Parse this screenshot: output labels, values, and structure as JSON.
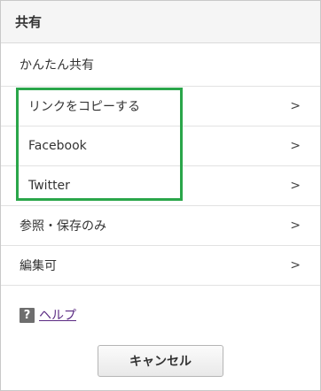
{
  "header": {
    "title": "共有"
  },
  "section": {
    "label": "かんたん共有"
  },
  "share_items": [
    {
      "label": "リンクをコピーする",
      "chevron": ">"
    },
    {
      "label": "Facebook",
      "chevron": ">"
    },
    {
      "label": "Twitter",
      "chevron": ">"
    }
  ],
  "permission_items": [
    {
      "label": "参照・保存のみ",
      "chevron": ">"
    },
    {
      "label": "編集可",
      "chevron": ">"
    }
  ],
  "help": {
    "icon_glyph": "?",
    "label": "ヘルプ"
  },
  "footer": {
    "cancel_label": "キャンセル"
  },
  "colors": {
    "highlight": "#2aa64a",
    "link": "#5a2a82",
    "header_bg": "#f5f5f5"
  }
}
